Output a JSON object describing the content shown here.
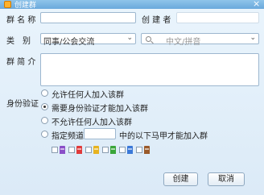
{
  "window": {
    "title": "创建群"
  },
  "form": {
    "name_label": "群 名 称",
    "name_value": "",
    "creator_label": "创 建 者",
    "creator_value": "",
    "category_label": "类　别",
    "category_value": "同事/公会交流",
    "search_placeholder": "中文/拼音",
    "intro_label": "群 简 介",
    "intro_value": ""
  },
  "auth": {
    "label": "身份验证",
    "options": [
      {
        "label": "允许任何人加入该群",
        "checked": false
      },
      {
        "label": "需要身份验证才能加入该群",
        "checked": true
      },
      {
        "label": "不允许任何人加入该群",
        "checked": false
      },
      {
        "label": "指定频道",
        "checked": false
      }
    ],
    "channel_value": "",
    "channel_suffix": "中的以下马甲才能加入群"
  },
  "vest_badges": [
    {
      "icon": "purple-vest-icon",
      "color": "#8a4fc8",
      "checked": false
    },
    {
      "icon": "red-vest-icon",
      "color": "#e03a3a",
      "checked": false
    },
    {
      "icon": "yellow-vest-icon",
      "color": "#e7b320",
      "checked": false
    },
    {
      "icon": "green-vest-icon",
      "color": "#3aa63a",
      "checked": false
    },
    {
      "icon": "blue-vest-icon",
      "color": "#3a78d8",
      "checked": false
    },
    {
      "icon": "brown-vest-icon",
      "color": "#9a5a2a",
      "checked": false
    }
  ],
  "buttons": {
    "create": "创建",
    "cancel": "取消"
  },
  "colors": {
    "titlebar": "#6aa9dc",
    "background": "#dfeefa"
  }
}
